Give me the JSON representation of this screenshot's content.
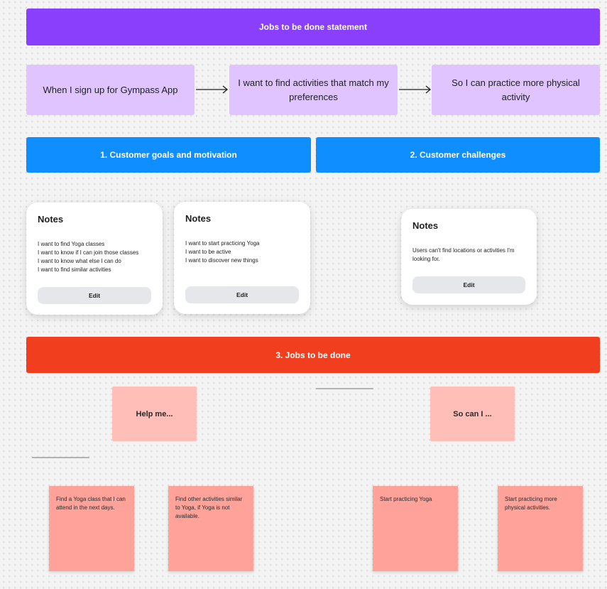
{
  "colors": {
    "statement_header": "#8a3ffc",
    "statement_box": "#e0c4ff",
    "section_blue": "#0f8eff",
    "section_red": "#f03e1f",
    "sticky_header": "#ffbeb8",
    "sticky_note": "#ffa39a",
    "card_button": "#e6e7ea"
  },
  "statement": {
    "title": "Jobs to be done statement",
    "steps": [
      "When I sign up for Gympass App",
      "I want to find activities that match my preferences",
      "So I can practice more physical activity"
    ],
    "connector_icon": "arrow-right-icon"
  },
  "sections": {
    "goals": "1. Customer goals and motivation",
    "challenges": "2. Customer challenges",
    "jobs": "3. Jobs to be done"
  },
  "cards": [
    {
      "title": "Notes",
      "lines": [
        "I want to find Yoga classes",
        "I want to know if I can join those classes",
        "I want to know what else I can do",
        "I want to find similar activities"
      ],
      "button": "Edit"
    },
    {
      "title": "Notes",
      "lines": [
        "I want to start practicing Yoga",
        "I want to be active",
        "I want to discover new things"
      ],
      "button": "Edit"
    },
    {
      "title": "Notes",
      "lines": [
        "Users can't find locations or activities I'm looking for."
      ],
      "button": "Edit"
    }
  ],
  "jobs": {
    "help_me": "Help me...",
    "so_can_i": "So can I ...",
    "stickies": [
      "Find a Yoga class that I can attend in the next days.",
      "Find other activities similar to Yoga, if Yoga is not available.",
      "Start practicing Yoga",
      "Start practicing more physical activities."
    ]
  }
}
